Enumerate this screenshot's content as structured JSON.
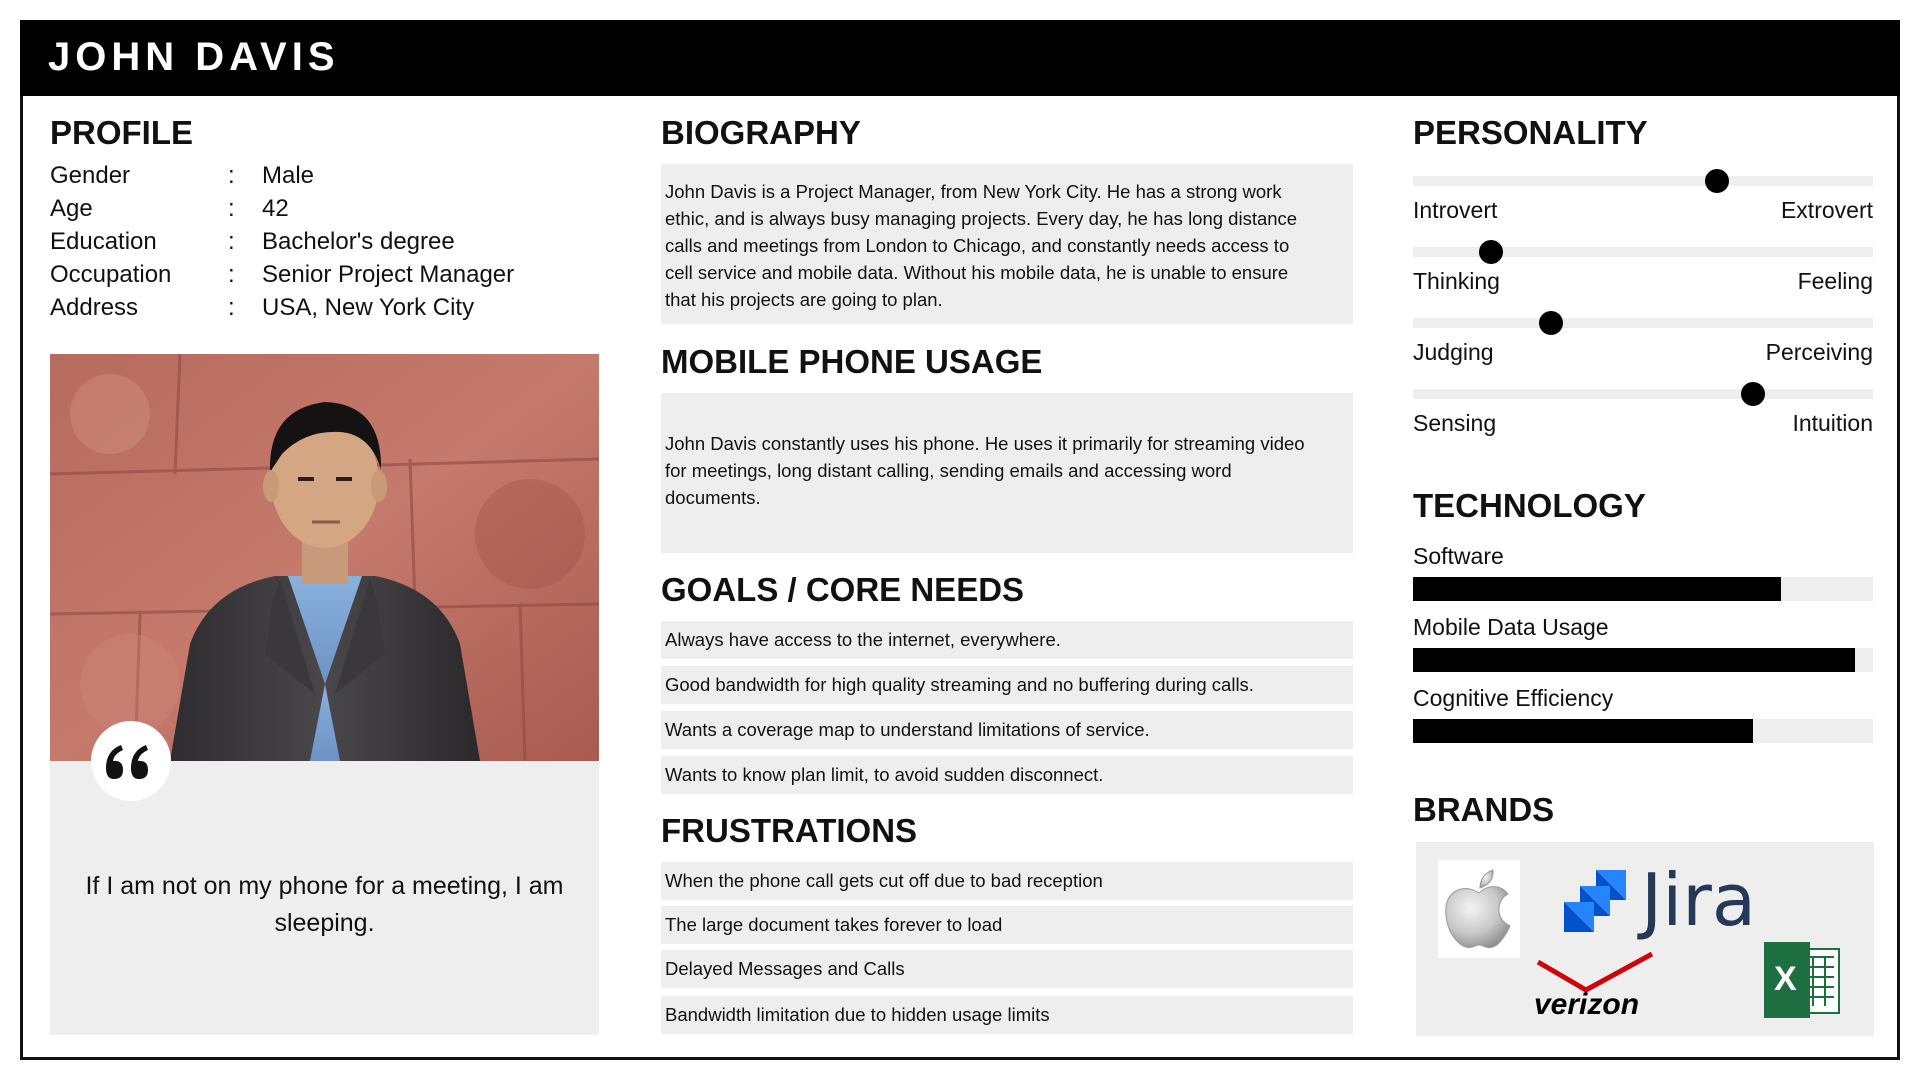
{
  "header": {
    "name": "JOHN DAVIS"
  },
  "profile": {
    "title": "PROFILE",
    "separator": ":",
    "rows": [
      {
        "label": "Gender",
        "value": "Male"
      },
      {
        "label": "Age",
        "value": "42"
      },
      {
        "label": "Education",
        "value": "Bachelor's degree"
      },
      {
        "label": "Occupation",
        "value": "Senior Project Manager"
      },
      {
        "label": "Address",
        "value": "USA, New York City"
      }
    ]
  },
  "quote": {
    "icon": "quote-icon",
    "text": "If I am not on my phone for a meeting, I am sleeping."
  },
  "biography": {
    "title": "BIOGRAPHY",
    "lines": [
      "John Davis is a Project Manager, from New York City. He has a strong work",
      "ethic, and is always busy managing projects. Every day, he has long distance",
      "calls and meetings from London to Chicago, and constantly needs access to",
      "cell service and mobile data. Without his mobile data, he is unable to ensure",
      "that his projects are going to plan."
    ]
  },
  "mobile_usage": {
    "title": "MOBILE PHONE USAGE",
    "lines": [
      "John Davis constantly uses his phone. He uses it primarily for streaming video",
      "for meetings, long distant calling, sending emails and accessing word",
      "documents."
    ]
  },
  "goals": {
    "title": "GOALS / CORE NEEDS",
    "items": [
      "Always have access to the internet, everywhere.",
      "Good bandwidth for high quality streaming and no buffering during calls.",
      "Wants a coverage map to understand limitations of service.",
      "Wants to know plan limit, to avoid sudden disconnect."
    ]
  },
  "frustrations": {
    "title": "FRUSTRATIONS",
    "items": [
      "When the phone call gets cut off due to bad reception",
      "The large document takes forever to load",
      "Delayed Messages and Calls",
      "Bandwidth limitation due to hidden usage limits"
    ]
  },
  "personality": {
    "title": "PERSONALITY",
    "traits": [
      {
        "left": "Introvert",
        "right": "Extrovert",
        "value": 0.66
      },
      {
        "left": "Thinking",
        "right": "Feeling",
        "value": 0.17
      },
      {
        "left": "Judging",
        "right": "Perceiving",
        "value": 0.3
      },
      {
        "left": "Sensing",
        "right": "Intuition",
        "value": 0.74
      }
    ]
  },
  "technology": {
    "title": "TECHNOLOGY",
    "items": [
      {
        "label": "Software",
        "value": 0.8
      },
      {
        "label": "Mobile Data Usage",
        "value": 0.96
      },
      {
        "label": "Cognitive Efficiency",
        "value": 0.74
      }
    ]
  },
  "brands": {
    "title": "BRANDS",
    "logos": [
      {
        "name": "apple-logo",
        "text": ""
      },
      {
        "name": "jira-logo",
        "text": "Jira"
      },
      {
        "name": "verizon-logo",
        "text": "verizon"
      },
      {
        "name": "excel-logo",
        "text": "X"
      }
    ]
  },
  "colors": {
    "dark": "#000000",
    "panel": "#eeeeee",
    "jira_blue": "#2684ff",
    "verizon_red": "#cd040b",
    "excel_green": "#1d6f42"
  }
}
